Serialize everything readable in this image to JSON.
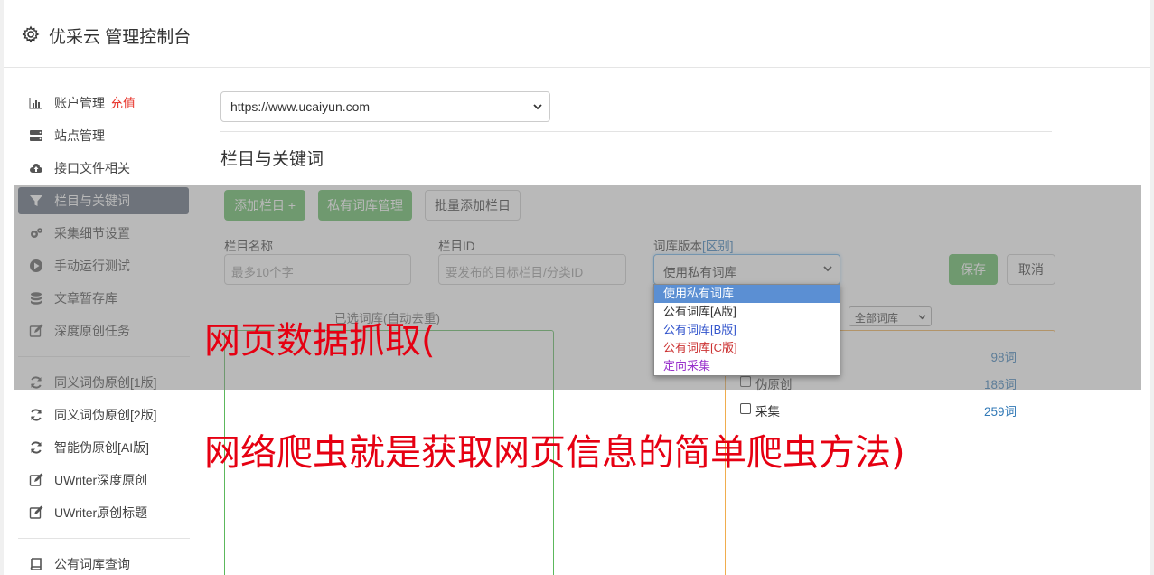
{
  "header": {
    "title": "优采云 管理控制台",
    "icon": "gear-icon"
  },
  "sidebar": {
    "items": [
      {
        "label": "账户管理",
        "extra": "充值",
        "icon": "bar-chart-icon"
      },
      {
        "label": "站点管理",
        "icon": "server-icon"
      },
      {
        "label": "接口文件相关",
        "icon": "cloud-upload-icon"
      },
      {
        "label": "栏目与关键词",
        "icon": "filter-icon",
        "active": true
      },
      {
        "label": "采集细节设置",
        "icon": "cogs-icon"
      },
      {
        "label": "手动运行测试",
        "icon": "play-icon"
      },
      {
        "label": "文章暂存库",
        "icon": "database-icon"
      },
      {
        "label": "深度原创任务",
        "icon": "edit-icon"
      },
      {
        "label": "同义词伪原创[1版]",
        "icon": "refresh-icon"
      },
      {
        "label": "同义词伪原创[2版]",
        "icon": "refresh-icon"
      },
      {
        "label": "智能伪原创[AI版]",
        "icon": "refresh-icon"
      },
      {
        "label": "UWriter深度原创",
        "icon": "edit-icon"
      },
      {
        "label": "UWriter原创标题",
        "icon": "edit-icon"
      },
      {
        "label": "公有词库查询",
        "icon": "book-icon"
      }
    ]
  },
  "main": {
    "site_select": "https://www.ucaiyun.com",
    "section_title": "栏目与关键词",
    "buttons": {
      "add_column": "添加栏目 +",
      "private_lib": "私有词库管理",
      "batch_add": "批量添加栏目",
      "save": "保存",
      "cancel": "取消"
    },
    "form": {
      "name_label": "栏目名称",
      "name_placeholder": "最多10个字",
      "id_label": "栏目ID",
      "id_placeholder": "要发布的目标栏目/分类ID",
      "lib_label": "词库版本",
      "lib_link": "[区别]",
      "lib_value": "使用私有词库",
      "lib_options": [
        "使用私有词库",
        "公有词库[A版]",
        "公有词库[B版]",
        "公有词库[C版]",
        "定向采集"
      ]
    },
    "left_box_head": "已选词库(自动去重)",
    "right_box_filter": "全部词库",
    "words": [
      {
        "name": "",
        "count": "98词"
      },
      {
        "name": "伪原创",
        "count": "186词"
      },
      {
        "name": "采集",
        "count": "259词"
      }
    ]
  },
  "watermark": {
    "line1": "网页数据抓取(",
    "line2": "网络爬虫就是获取网页信息的简单爬虫方法)"
  },
  "colors": {
    "accent_green": "#5cb85c",
    "active_nav": "#5a6575",
    "recharge": "#e8382f",
    "watermark": "#e60012",
    "link": "#337ab7"
  }
}
